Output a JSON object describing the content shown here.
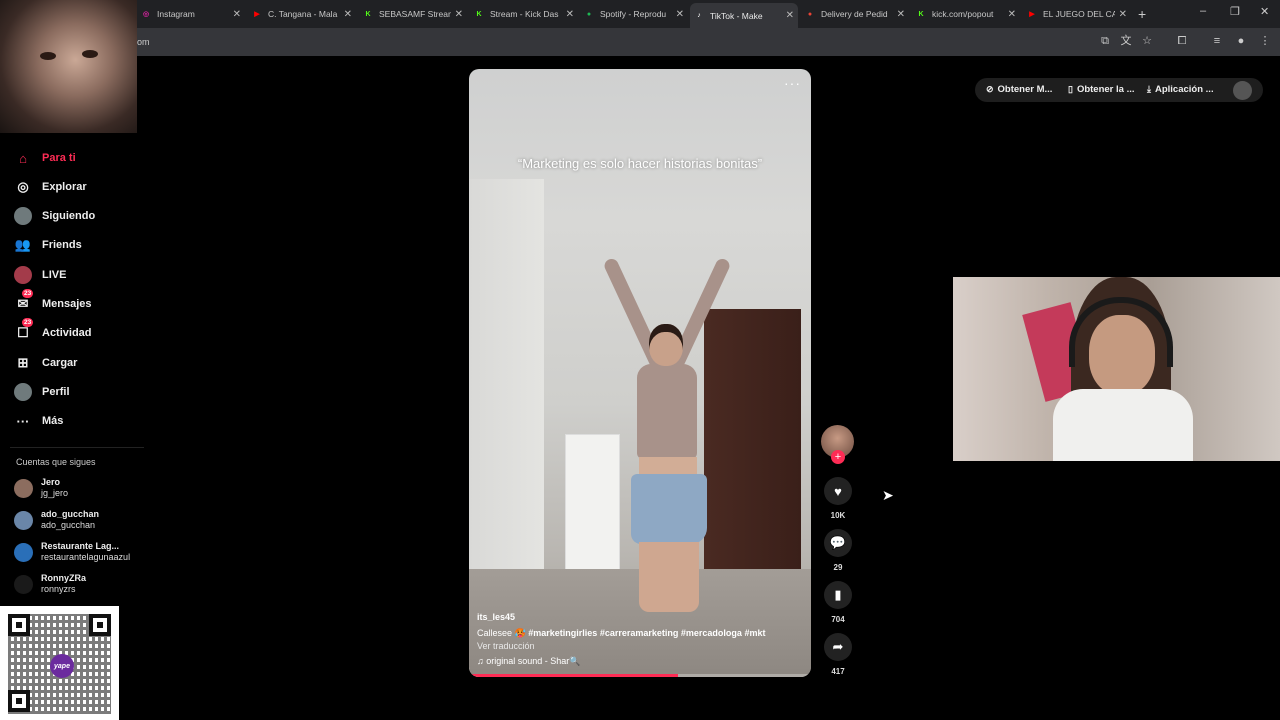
{
  "browser": {
    "tabs": [
      {
        "title": "Instagram",
        "color": "#d6249f",
        "glyph": "◎"
      },
      {
        "title": "C. Tangana - Mala",
        "color": "#ff0000",
        "glyph": "▶"
      },
      {
        "title": "SEBASAMF Stream",
        "color": "#53fc18",
        "glyph": "K"
      },
      {
        "title": "Stream - Kick Das",
        "color": "#53fc18",
        "glyph": "K"
      },
      {
        "title": "Spotify - Reprodu",
        "color": "#1db954",
        "glyph": "●"
      },
      {
        "title": "TikTok - Make",
        "color": "#ffffff",
        "glyph": "♪"
      },
      {
        "title": "Delivery de Pedid",
        "color": "#ea4335",
        "glyph": "●"
      },
      {
        "title": "kick.com/popout",
        "color": "#53fc18",
        "glyph": "K"
      },
      {
        "title": "EL JUEGO DEL CA",
        "color": "#ff0000",
        "glyph": "▶"
      }
    ],
    "address_fragment": "om"
  },
  "sidebar": {
    "nav": [
      {
        "label": "Para ti",
        "icon": "home-icon",
        "glyph": "⌂"
      },
      {
        "label": "Explorar",
        "icon": "compass-icon",
        "glyph": "◎"
      },
      {
        "label": "Siguiendo",
        "icon": "following-avatar-icon",
        "glyph": ""
      },
      {
        "label": "Friends",
        "icon": "friends-icon",
        "glyph": "👥"
      },
      {
        "label": "LIVE",
        "icon": "live-icon",
        "glyph": ""
      },
      {
        "label": "Mensajes",
        "icon": "message-icon",
        "glyph": "✉",
        "badge": "23"
      },
      {
        "label": "Actividad",
        "icon": "activity-icon",
        "glyph": "☐",
        "badge": "23"
      },
      {
        "label": "Cargar",
        "icon": "upload-icon",
        "glyph": "⊞"
      },
      {
        "label": "Perfil",
        "icon": "profile-avatar-icon",
        "glyph": ""
      },
      {
        "label": "Más",
        "icon": "more-icon",
        "glyph": "···"
      }
    ],
    "following_title": "Cuentas que sigues",
    "following": [
      {
        "name": "Jero",
        "handle": "jg_jero",
        "color": "#8c6d5f"
      },
      {
        "name": "ado_gucchan",
        "handle": "ado_gucchan",
        "color": "#6a86a8"
      },
      {
        "name": "Restaurante Lag...",
        "handle": "restaurantelagunaazul",
        "color": "#2a6fb8"
      },
      {
        "name": "RonnyZRa",
        "handle": "ronnyzrs",
        "color": "#1a1a1a"
      }
    ]
  },
  "header": {
    "buttons": [
      {
        "label": "Obtener M...",
        "icon": "coin-icon"
      },
      {
        "label": "Obtener la ...",
        "icon": "phone-icon"
      },
      {
        "label": "Aplicación ...",
        "icon": "download-icon"
      }
    ]
  },
  "video": {
    "caption": "“Marketing es solo hacer historias bonitas”",
    "username": "its_les45",
    "description_prefix": "Callesee 🥵",
    "hashtags": [
      "#marketingirlies",
      "#carreramarketing",
      "#mercadologa",
      "#mkt"
    ],
    "translate": "Ver traducción",
    "sound": "♫ original sound - Shar🔍",
    "progress": 0.61
  },
  "actions": {
    "likes": "10K",
    "comments": "29",
    "saves": "704",
    "shares": "417"
  },
  "qr": {
    "brand": "yape"
  },
  "colors": {
    "accent": "#fe2c55"
  }
}
